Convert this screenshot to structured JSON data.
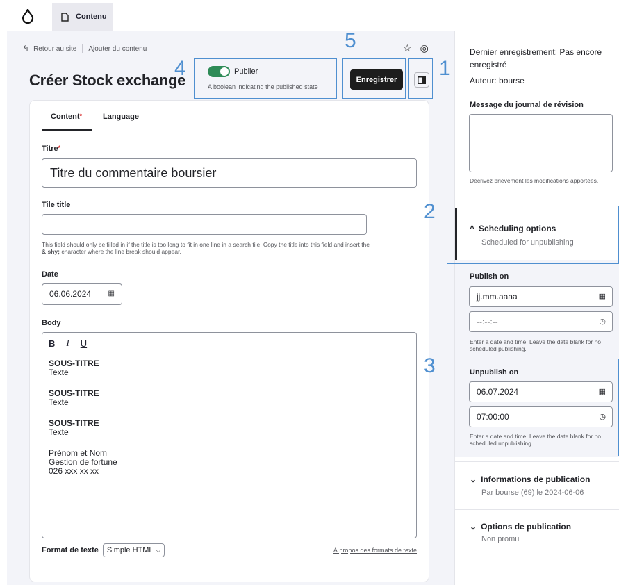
{
  "toolbar": {
    "tab_label": "Contenu"
  },
  "breadcrumb": {
    "back_label": "Retour au site",
    "current_label": "Ajouter du contenu"
  },
  "page": {
    "title": "Créer Stock exchange"
  },
  "publish": {
    "label": "Publier",
    "description": "A boolean indicating the published state",
    "enabled": true
  },
  "actions": {
    "save_label": "Enregistrer"
  },
  "tabs": [
    {
      "label": "Content",
      "required": "*"
    },
    {
      "label": "Language"
    }
  ],
  "form": {
    "titre": {
      "label": "Titre",
      "required": "*",
      "value": "Titre du commentaire boursier"
    },
    "tile_title": {
      "label": "Tile title",
      "value": "",
      "help_part1": "This field should only be filled in if the title is too long to fit in one line in a search tile. Copy the title into this field and insert the ",
      "help_bold": "& shy;",
      "help_part2": " character where the line break should appear."
    },
    "date": {
      "label": "Date",
      "value": "06.06.2024"
    },
    "body": {
      "label": "Body",
      "toolbar": {
        "bold": "B",
        "italic": "I",
        "underline": "U"
      },
      "blocks": [
        {
          "heading": "SOUS-TITRE",
          "text": "Texte"
        },
        {
          "heading": "SOUS-TITRE",
          "text": "Texte"
        },
        {
          "heading": "SOUS-TITRE",
          "text": "Texte"
        }
      ],
      "signature": [
        "Prénom et Nom",
        "Gestion de fortune",
        "026 xxx xx xx"
      ]
    },
    "format": {
      "label": "Format de texte",
      "value": "Simple HTML",
      "link": "À propos des formats de texte"
    }
  },
  "sidebar": {
    "last_saved_label": "Dernier enregistrement:",
    "last_saved_value": "Pas encore enregistré",
    "author_label": "Auteur:",
    "author_value": "bourse",
    "revision": {
      "label": "Message du journal de révision",
      "help": "Décrivez brièvement les modifications apportées."
    },
    "scheduling": {
      "title": "Scheduling options",
      "subtitle": "Scheduled for unpublishing"
    },
    "publish_on": {
      "label": "Publish on",
      "date_placeholder": "jj.mm.aaaa",
      "time_placeholder": "--:--:--",
      "help": "Enter a date and time. Leave the date blank for no scheduled publishing."
    },
    "unpublish_on": {
      "label": "Unpublish on",
      "date_value": "06.07.2024",
      "time_value": "07:00:00",
      "help": "Enter a date and time. Leave the date blank for no scheduled unpublishing."
    },
    "info": {
      "title": "Informations de publication",
      "subtitle": "Par bourse (69) le 2024-06-06"
    },
    "options": {
      "title": "Options de publication",
      "subtitle": "Non promu"
    }
  },
  "annotations": [
    "1",
    "2",
    "3",
    "4",
    "5"
  ],
  "colors": {
    "accent": "#2e8b57",
    "annotation": "#4f8fd0",
    "save_button": "#1d1d1d"
  }
}
